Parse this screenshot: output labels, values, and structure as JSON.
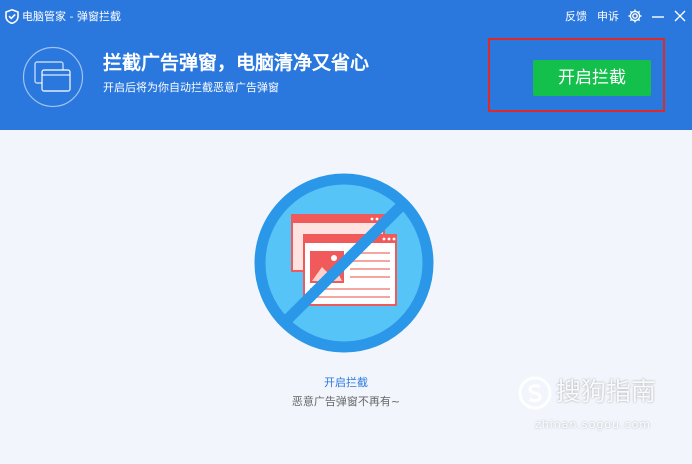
{
  "window": {
    "title": "电脑管家 - 弹窗拦截",
    "feedback_label": "反馈",
    "complaint_label": "申诉"
  },
  "icons": [
    "shield-logo-icon",
    "gear-icon",
    "minimize-icon",
    "close-icon",
    "popup-windows-icon",
    "blocked-popup-icon"
  ],
  "banner": {
    "title": "拦截广告弹窗，电脑清净又省心",
    "subtitle": "开启后将为你自动拦截恶意广告弹窗",
    "enable_button_label": "开启拦截"
  },
  "main": {
    "caption_title": "开启拦截",
    "caption_subtitle": "恶意广告弹窗不再有~"
  },
  "watermark": {
    "brand": "搜狗指南",
    "url": "zhinan.sogou.com"
  },
  "colors": {
    "header_blue": "#2a78de",
    "button_green": "#14c04c",
    "highlight_red": "#e02a2a",
    "circle_blue": "#2a97e8",
    "circle_fill": "#56c4f7",
    "popup_red": "#f05a5a",
    "background": "#f2f6fc"
  }
}
